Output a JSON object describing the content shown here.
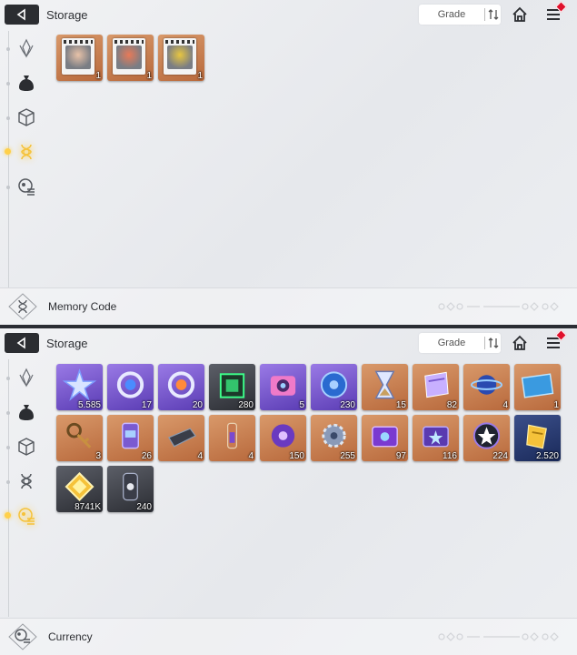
{
  "top": {
    "header": {
      "title": "Storage",
      "grade_label": "Grade"
    },
    "footer": {
      "label": "Memory Code"
    },
    "active_tab_index": 3,
    "items": [
      {
        "name": "memory-code-1",
        "count": "1",
        "rarity": "orange",
        "accent": "#e8c2a8"
      },
      {
        "name": "memory-code-2",
        "count": "1",
        "rarity": "orange",
        "accent": "#e87a58"
      },
      {
        "name": "memory-code-3",
        "count": "1",
        "rarity": "orange",
        "accent": "#e8c640"
      }
    ]
  },
  "bottom": {
    "header": {
      "title": "Storage",
      "grade_label": "Grade"
    },
    "footer": {
      "label": "Currency"
    },
    "active_tab_index": 4,
    "items": [
      {
        "name": "crystal-star",
        "count": "5.585",
        "rarity": "purple"
      },
      {
        "name": "ring-blue",
        "count": "17",
        "rarity": "purple"
      },
      {
        "name": "ring-orange",
        "count": "20",
        "rarity": "purple"
      },
      {
        "name": "green-cube",
        "count": "280",
        "rarity": "dark"
      },
      {
        "name": "camera",
        "count": "5",
        "rarity": "purple"
      },
      {
        "name": "blue-disc",
        "count": "230",
        "rarity": "purple"
      },
      {
        "name": "hourglass",
        "count": "15",
        "rarity": "orange"
      },
      {
        "name": "ticket",
        "count": "82",
        "rarity": "orange"
      },
      {
        "name": "planet-orb",
        "count": "4",
        "rarity": "orange"
      },
      {
        "name": "blueprint",
        "count": "1",
        "rarity": "orange"
      },
      {
        "name": "key-chain",
        "count": "3",
        "rarity": "orange"
      },
      {
        "name": "canister",
        "count": "26",
        "rarity": "orange"
      },
      {
        "name": "black-device",
        "count": "4",
        "rarity": "orange"
      },
      {
        "name": "vial",
        "count": "4",
        "rarity": "orange"
      },
      {
        "name": "purple-flower",
        "count": "150",
        "rarity": "orange"
      },
      {
        "name": "gear",
        "count": "255",
        "rarity": "orange"
      },
      {
        "name": "purple-box",
        "count": "97",
        "rarity": "orange"
      },
      {
        "name": "star-box",
        "count": "116",
        "rarity": "orange"
      },
      {
        "name": "dark-star-chip",
        "count": "224",
        "rarity": "orange"
      },
      {
        "name": "gold-coin-stack",
        "count": "2.520",
        "rarity": "gold"
      },
      {
        "name": "gold-diamond",
        "count": "8741K",
        "rarity": "dark"
      },
      {
        "name": "dark-capsule",
        "count": "240",
        "rarity": "dark"
      }
    ]
  }
}
